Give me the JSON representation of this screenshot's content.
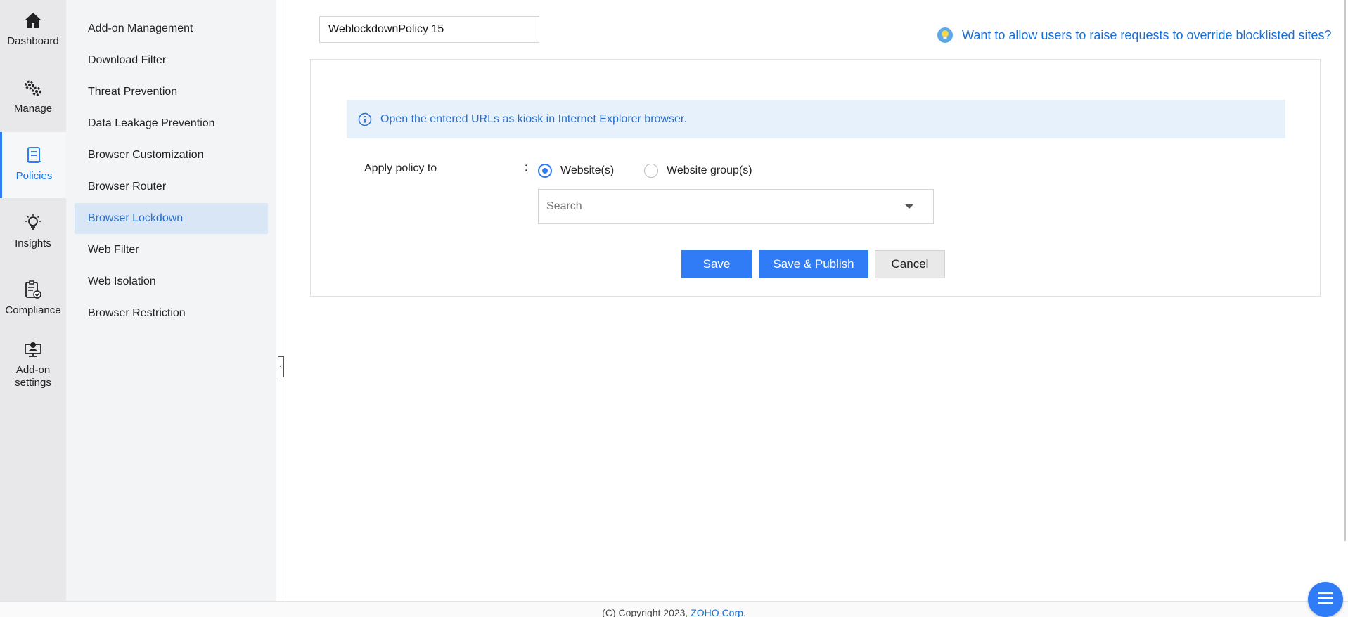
{
  "rail": {
    "items": [
      {
        "label": "Dashboard",
        "icon": "home-icon"
      },
      {
        "label": "Manage",
        "icon": "gears-icon"
      },
      {
        "label": "Policies",
        "icon": "policy-icon",
        "active": true
      },
      {
        "label": "Insights",
        "icon": "bulb-icon"
      },
      {
        "label": "Compliance",
        "icon": "clipboard-check-icon"
      },
      {
        "label": "Add-on settings",
        "icon": "monitor-user-icon"
      }
    ]
  },
  "submenu": {
    "items": [
      {
        "label": "Add-on Management"
      },
      {
        "label": "Download Filter"
      },
      {
        "label": "Threat Prevention"
      },
      {
        "label": "Data Leakage Prevention"
      },
      {
        "label": "Browser Customization"
      },
      {
        "label": "Browser Router"
      },
      {
        "label": "Browser Lockdown",
        "active": true
      },
      {
        "label": "Web Filter"
      },
      {
        "label": "Web Isolation"
      },
      {
        "label": "Browser Restriction"
      }
    ]
  },
  "main": {
    "policy_name": "WeblockdownPolicy 15",
    "help_link": "Want to allow users to raise requests to override blocklisted sites?",
    "info_text": "Open the entered URLs as kiosk in Internet Explorer browser.",
    "apply_label": "Apply policy to",
    "colon": ":",
    "radio_options": [
      {
        "label": "Website(s)",
        "checked": true
      },
      {
        "label": "Website group(s)",
        "checked": false
      }
    ],
    "search_placeholder": "Search",
    "buttons": {
      "save": "Save",
      "save_publish": "Save & Publish",
      "cancel": "Cancel"
    }
  },
  "footer": {
    "copyright": "(C) Copyright 2023,",
    "company_link": "ZOHO Corp."
  },
  "colors": {
    "accent": "#2f7cf6",
    "link": "#1a6fd3",
    "info_bg": "#e6f1fc",
    "active_submenu_bg": "#d9e6f5"
  }
}
